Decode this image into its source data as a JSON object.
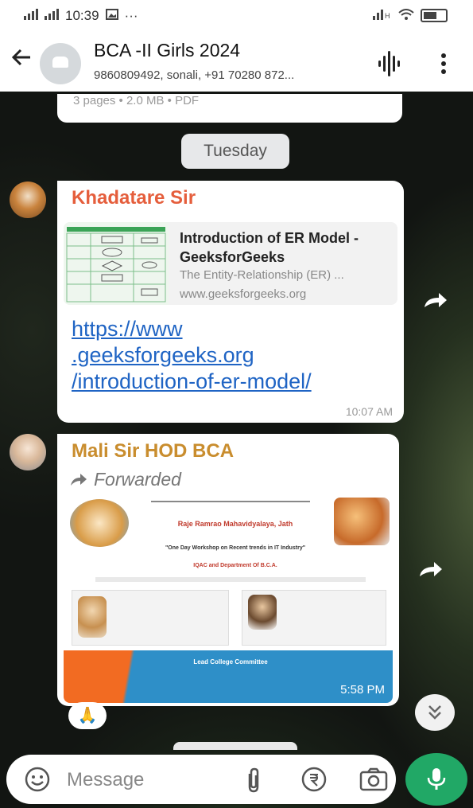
{
  "status_bar": {
    "time": "10:39",
    "left_icons": [
      "signal-icon",
      "signal-icon",
      "gallery-icon"
    ],
    "more": "···",
    "right_icons": [
      "sim-icon",
      "wifi-icon",
      "battery-icon"
    ]
  },
  "header": {
    "title": "BCA -II Girls 2024",
    "subtitle": "9860809492, sonali, +91 70280 872..."
  },
  "messages": {
    "document_meta": "3 pages • 2.0 MB • PDF",
    "day_chip": "Tuesday",
    "msg1": {
      "sender": "Khadatare Sir",
      "sender_color": "#e55e3c",
      "preview_title": "Introduction of ER Model - GeeksforGeeks",
      "preview_desc": "The Entity-Relationship (ER) ...",
      "preview_site": "www.geeksforgeeks.org",
      "link_line1": "https://www",
      "link_line2": ".geeksforgeeks.org",
      "link_line3": "/introduction-of-er-model/",
      "time": "10:07 AM"
    },
    "msg2": {
      "sender": "Mali Sir HOD BCA",
      "sender_color": "#c98d2e",
      "forwarded": "Forwarded",
      "poster_college": "Raje Ramrao Mahavidyalaya, Jath",
      "poster_event": "\"One Day Workshop on Recent trends in IT Industry\"",
      "poster_org": "IQAC and Department Of B.C.A.",
      "poster_footer": "Lead College Committee",
      "time": "5:58 PM"
    },
    "reaction": "🙏"
  },
  "input": {
    "placeholder": "Message"
  },
  "colors": {
    "accent_green": "#21a866",
    "link_blue": "#1f64c4"
  }
}
